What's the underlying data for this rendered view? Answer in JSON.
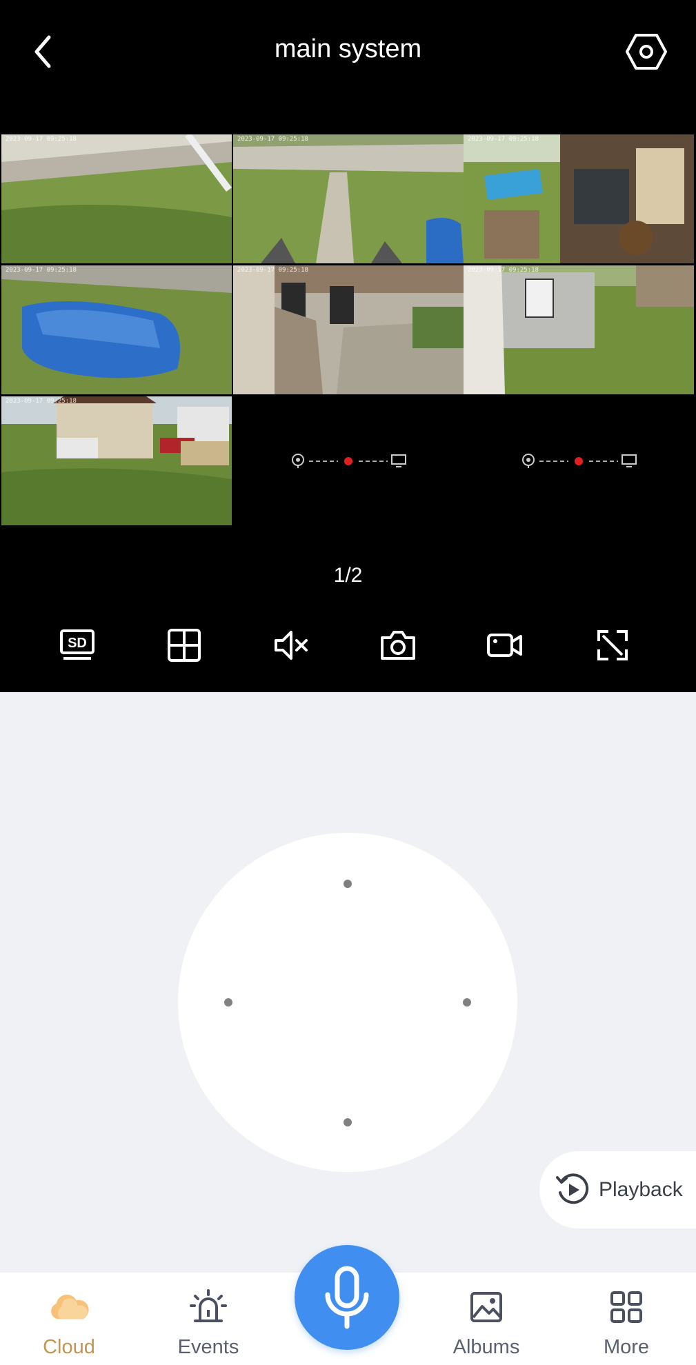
{
  "header": {
    "title": "main system"
  },
  "cameras": [
    {
      "status": "online",
      "timestamp": "2023-09-17 09:25:18"
    },
    {
      "status": "online",
      "timestamp": "2023-09-17 09:25:18"
    },
    {
      "status": "online",
      "timestamp": "2023-09-17 09:25:18"
    },
    {
      "status": "online",
      "timestamp": "2023-09-17 09:25:18"
    },
    {
      "status": "online",
      "timestamp": "2023-09-17 09:25:18"
    },
    {
      "status": "online",
      "timestamp": "2023-09-17 09:25:18"
    },
    {
      "status": "online",
      "timestamp": "2023-09-17 09:25:18"
    },
    {
      "status": "offline",
      "timestamp": ""
    },
    {
      "status": "offline",
      "timestamp": ""
    }
  ],
  "pagination": {
    "indicator": "1/2"
  },
  "toolbar": {
    "items": [
      "sd-icon",
      "grid-layout-icon",
      "mute-icon",
      "camera-icon",
      "video-record-icon",
      "fullscreen-icon"
    ]
  },
  "playback": {
    "label": "Playback"
  },
  "nav": {
    "items": [
      {
        "label": "Cloud",
        "icon": "cloud-icon",
        "active": true
      },
      {
        "label": "Events",
        "icon": "alarm-icon",
        "active": false
      },
      {
        "label": "Albums",
        "icon": "image-icon",
        "active": false
      },
      {
        "label": "More",
        "icon": "more-grid-icon",
        "active": false
      }
    ],
    "center_icon": "microphone-icon"
  },
  "colors": {
    "accent": "#3f8ef0",
    "active_nav": "#c49450",
    "offline_dot": "#e02020"
  }
}
